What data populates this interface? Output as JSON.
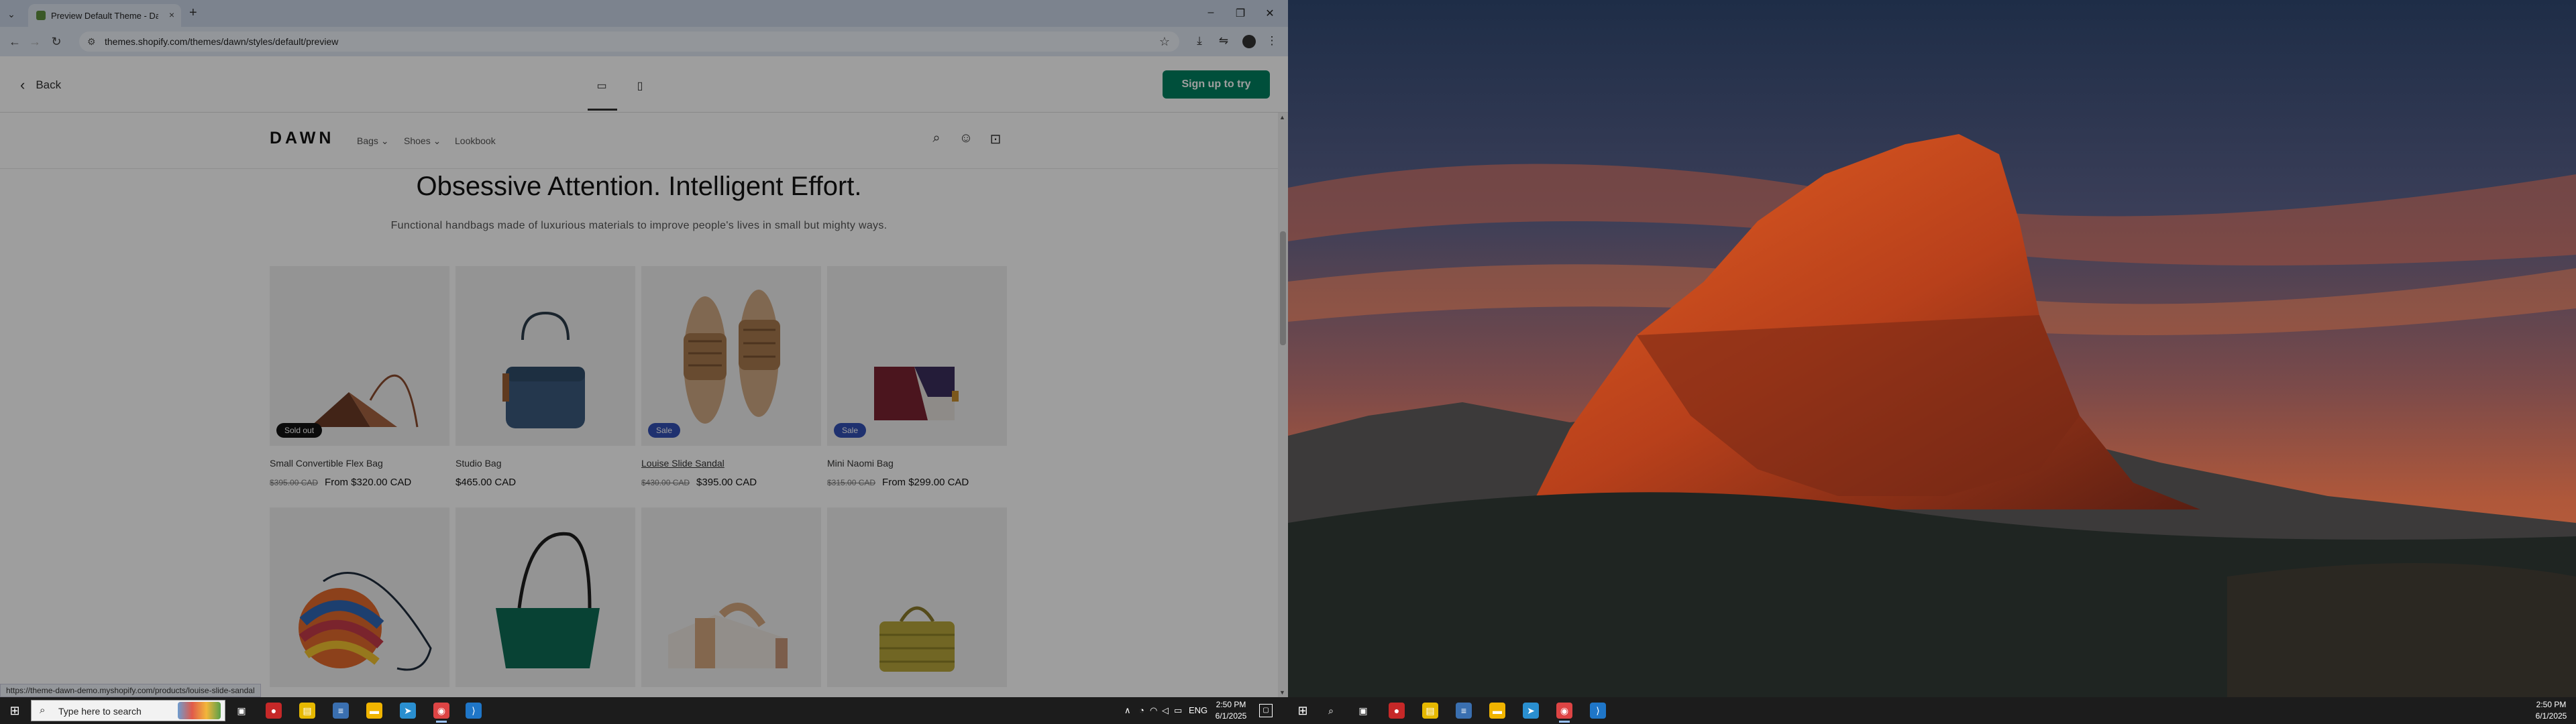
{
  "browser": {
    "tab_title": "Preview Default Theme - Dawn",
    "tab_close": "×",
    "new_tab": "+",
    "url": "themes.shopify.com/themes/dawn/styles/default/preview",
    "status_url": "https://theme-dawn-demo.myshopify.com/products/louise-slide-sandal",
    "window_controls": {
      "minimize": "–",
      "maximize": "❐",
      "close": "✕"
    }
  },
  "preview_bar": {
    "back_label": "Back",
    "signup_label": "Sign up to try",
    "device_selected": "desktop"
  },
  "store": {
    "logo": "DAWN",
    "nav": [
      "Bags",
      "Shoes",
      "Lookbook"
    ],
    "headline": "Obsessive Attention. Intelligent Effort.",
    "subheadline": "Functional handbags made of luxurious materials to improve people's lives in small but mighty ways.",
    "products": [
      {
        "name": "Small Convertible Flex Bag",
        "old_price": "$395.00 CAD",
        "price": "From $320.00 CAD",
        "badge": "Sold out"
      },
      {
        "name": "Studio Bag",
        "old_price": "",
        "price": "$465.00 CAD",
        "badge": ""
      },
      {
        "name": "Louise Slide Sandal",
        "old_price": "$430.00 CAD",
        "price": "$395.00 CAD",
        "badge": "Sale"
      },
      {
        "name": "Mini Naomi Bag",
        "old_price": "$315.00 CAD",
        "price": "From $299.00 CAD",
        "badge": "Sale"
      }
    ]
  },
  "taskbar": {
    "search_placeholder": "Type here to search",
    "left_time": "2:50 PM",
    "left_date": "6/1/2025",
    "language": "ENG",
    "right_time": "2:50 PM",
    "right_date": "6/1/2025"
  },
  "colors": {
    "brand_green": "#008060",
    "badge_dark": "#121212",
    "badge_sale": "#334fb4"
  }
}
